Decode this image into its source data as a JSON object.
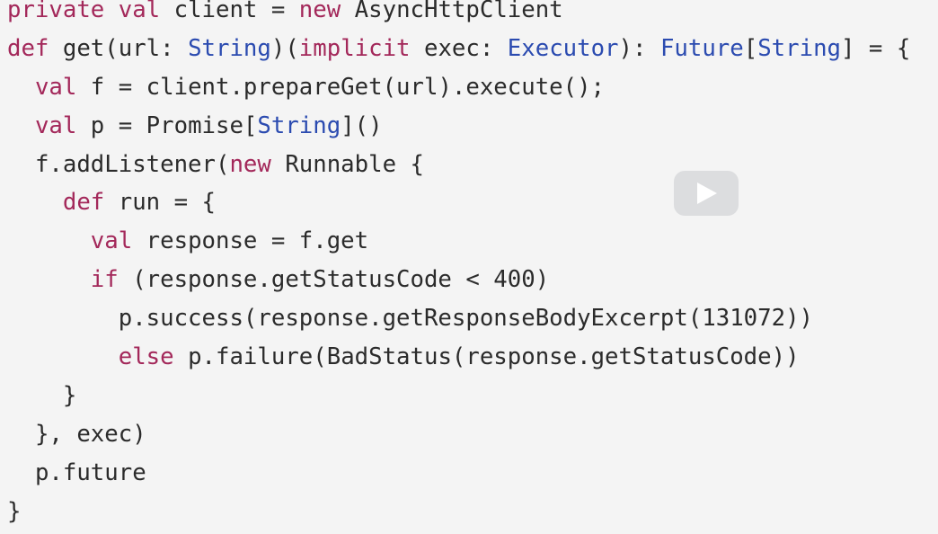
{
  "colors": {
    "background": "#f4f4f4",
    "text": "#2b2b2b",
    "keyword": "#a3285a",
    "type": "#2b4bb0"
  },
  "play_button": {
    "icon": "play-icon"
  },
  "code_lines": [
    {
      "indent": 0,
      "tokens": [
        [
          "private",
          "kw"
        ],
        [
          " ",
          ""
        ],
        [
          "val",
          "kw"
        ],
        [
          " client = ",
          ""
        ],
        [
          "new",
          "kw"
        ],
        [
          " AsyncHttpClient",
          ""
        ]
      ]
    },
    {
      "indent": 0,
      "tokens": [
        [
          "def",
          "kw"
        ],
        [
          " get(url: ",
          ""
        ],
        [
          "String",
          "ty"
        ],
        [
          ")(",
          ""
        ],
        [
          "implicit",
          "kw"
        ],
        [
          " exec: ",
          ""
        ],
        [
          "Executor",
          "ty"
        ],
        [
          "): ",
          ""
        ],
        [
          "Future",
          "ty"
        ],
        [
          "[",
          ""
        ],
        [
          "String",
          "ty"
        ],
        [
          "] = {",
          ""
        ]
      ]
    },
    {
      "indent": 1,
      "tokens": [
        [
          "val",
          "kw"
        ],
        [
          " f = client.prepareGet(url).execute();",
          ""
        ]
      ]
    },
    {
      "indent": 1,
      "tokens": [
        [
          "val",
          "kw"
        ],
        [
          " p = Promise[",
          ""
        ],
        [
          "String",
          "ty"
        ],
        [
          "]()",
          ""
        ]
      ]
    },
    {
      "indent": 1,
      "tokens": [
        [
          "f.addListener(",
          ""
        ],
        [
          "new",
          "kw"
        ],
        [
          " Runnable {",
          ""
        ]
      ]
    },
    {
      "indent": 2,
      "tokens": [
        [
          "def",
          "kw"
        ],
        [
          " run = {",
          ""
        ]
      ]
    },
    {
      "indent": 3,
      "tokens": [
        [
          "val",
          "kw"
        ],
        [
          " response = f.get",
          ""
        ]
      ]
    },
    {
      "indent": 3,
      "tokens": [
        [
          "if",
          "kw"
        ],
        [
          " (response.getStatusCode < 400)",
          ""
        ]
      ]
    },
    {
      "indent": 4,
      "tokens": [
        [
          "p.success(response.getResponseBodyExcerpt(131072))",
          ""
        ]
      ]
    },
    {
      "indent": 4,
      "tokens": [
        [
          "else",
          "kw"
        ],
        [
          " p.failure(BadStatus(response.getStatusCode))",
          ""
        ]
      ]
    },
    {
      "indent": 2,
      "tokens": [
        [
          "}",
          ""
        ]
      ]
    },
    {
      "indent": 1,
      "tokens": [
        [
          "}, exec)",
          ""
        ]
      ]
    },
    {
      "indent": 1,
      "tokens": [
        [
          "p.future",
          ""
        ]
      ]
    },
    {
      "indent": 0,
      "tokens": [
        [
          "}",
          ""
        ]
      ]
    }
  ]
}
